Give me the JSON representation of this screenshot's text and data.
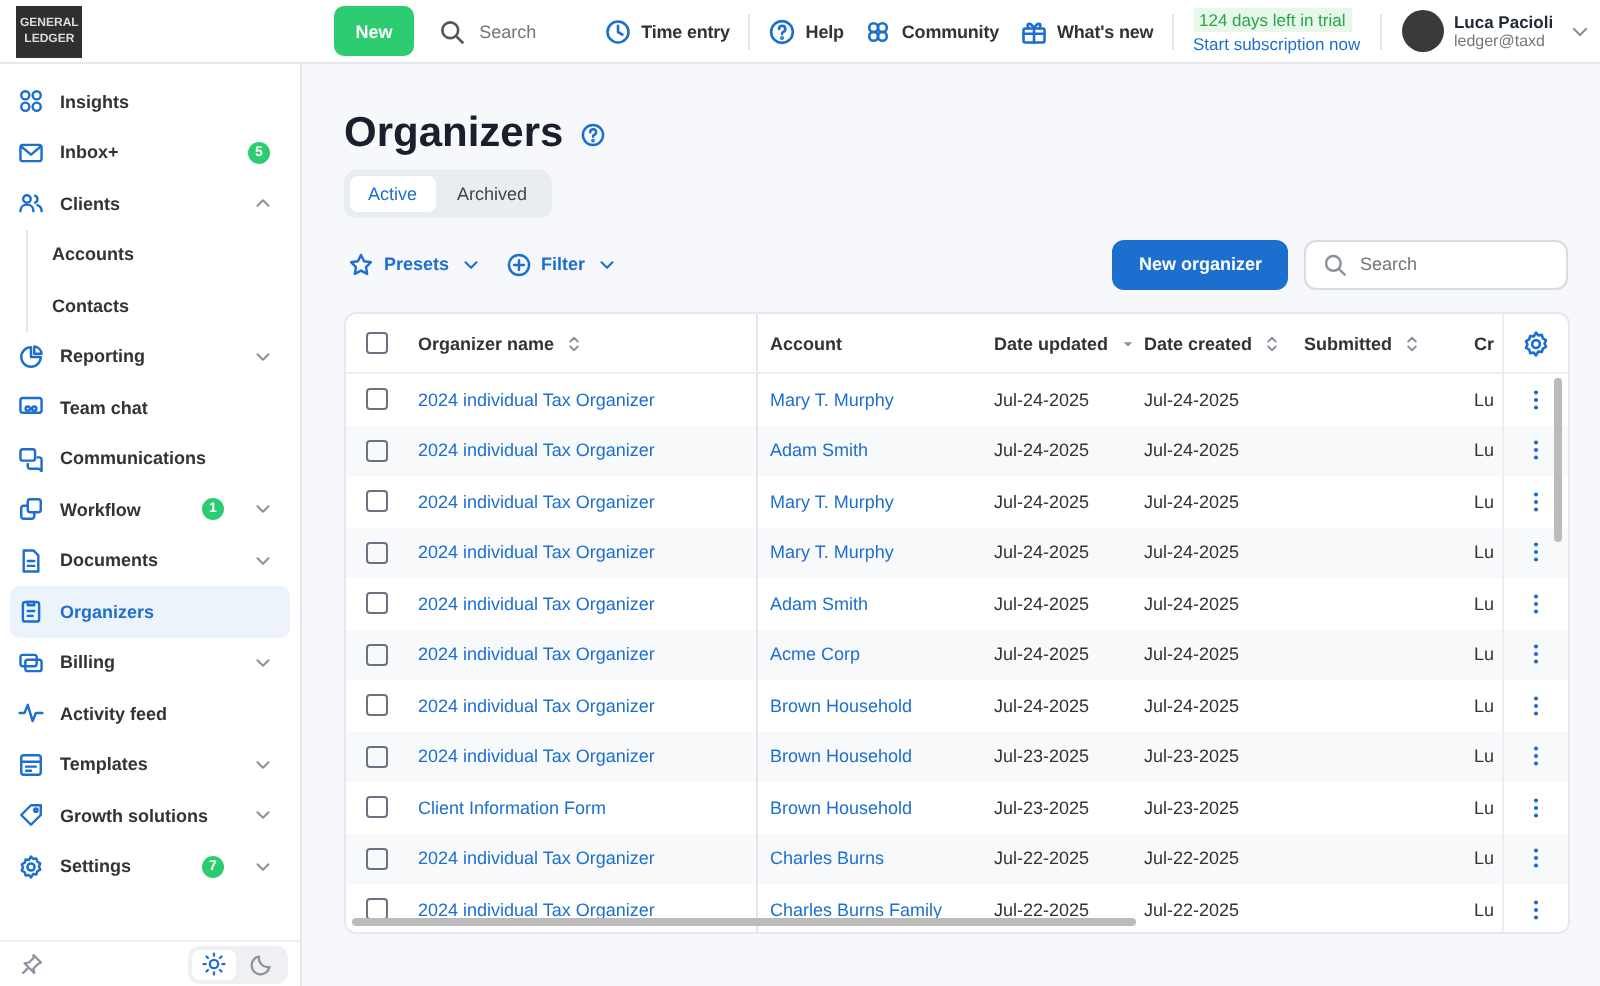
{
  "logo": {
    "lines": [
      "GENERAL",
      "LEDGER"
    ]
  },
  "topbar": {
    "new_button": "New",
    "search": {
      "placeholder": "Search"
    },
    "links": [
      "Time entry",
      "Help",
      "Community",
      "What's new"
    ],
    "trial": {
      "days": "124 days left in trial",
      "cta": "Start subscription now"
    },
    "user": {
      "name": "Luca Pacioli",
      "email": "ledger@taxd"
    }
  },
  "sidebar": {
    "items": [
      {
        "label": "Insights",
        "kind": "link",
        "selected": false
      },
      {
        "label": "Inbox+",
        "kind": "link",
        "selected": false,
        "badge": "5"
      },
      {
        "label": "Clients",
        "kind": "group",
        "selected": false,
        "expanded": true,
        "children": [
          {
            "label": "Accounts",
            "selected": false
          },
          {
            "label": "Contacts",
            "selected": false
          }
        ]
      },
      {
        "label": "Reporting",
        "kind": "group",
        "selected": false,
        "expanded": false
      },
      {
        "label": "Team chat",
        "kind": "link",
        "selected": false
      },
      {
        "label": "Communications",
        "kind": "link",
        "selected": false
      },
      {
        "label": "Workflow",
        "kind": "group",
        "selected": false,
        "expanded": false,
        "badge": "1"
      },
      {
        "label": "Documents",
        "kind": "group",
        "selected": false,
        "expanded": false
      },
      {
        "label": "Organizers",
        "kind": "link",
        "selected": true
      },
      {
        "label": "Billing",
        "kind": "group",
        "selected": false,
        "expanded": false
      },
      {
        "label": "Activity feed",
        "kind": "link",
        "selected": false
      },
      {
        "label": "Templates",
        "kind": "group",
        "selected": false,
        "expanded": false
      },
      {
        "label": "Growth solutions",
        "kind": "group",
        "selected": false,
        "expanded": false
      },
      {
        "label": "Settings",
        "kind": "group",
        "selected": false,
        "expanded": false,
        "badge": "7"
      }
    ],
    "theme": {
      "light_selected": true
    }
  },
  "page": {
    "title": "Organizers",
    "tabs": [
      {
        "label": "Active",
        "selected": true
      },
      {
        "label": "Archived",
        "selected": false
      }
    ],
    "toolbar": {
      "presets": "Presets",
      "filter": "Filter",
      "new_button": "New organizer",
      "search": {
        "placeholder": "Search"
      }
    },
    "table": {
      "select_all": {
        "checked": false
      },
      "columns": [
        {
          "label": "Organizer name",
          "kind": "sortable"
        },
        {
          "label": "Account",
          "kind": "plain"
        },
        {
          "label": "Date updated",
          "kind": "sorted"
        },
        {
          "label": "Date created",
          "kind": "sortable"
        },
        {
          "label": "Submitted",
          "kind": "sortable"
        },
        {
          "label": "Cr",
          "kind": "plain"
        }
      ],
      "rows": [
        {
          "checked": false,
          "cells": [
            "2024 individual Tax Organizer",
            "Mary T. Murphy",
            "Jul-24-2025",
            "Jul-24-2025",
            "",
            "Lu"
          ]
        },
        {
          "checked": false,
          "cells": [
            "2024 individual Tax Organizer",
            "Adam Smith",
            "Jul-24-2025",
            "Jul-24-2025",
            "",
            "Lu"
          ]
        },
        {
          "checked": false,
          "cells": [
            "2024 individual Tax Organizer",
            "Mary T. Murphy",
            "Jul-24-2025",
            "Jul-24-2025",
            "",
            "Lu"
          ]
        },
        {
          "checked": false,
          "cells": [
            "2024 individual Tax Organizer",
            "Mary T. Murphy",
            "Jul-24-2025",
            "Jul-24-2025",
            "",
            "Lu"
          ]
        },
        {
          "checked": false,
          "cells": [
            "2024 individual Tax Organizer",
            "Adam Smith",
            "Jul-24-2025",
            "Jul-24-2025",
            "",
            "Lu"
          ]
        },
        {
          "checked": false,
          "cells": [
            "2024 individual Tax Organizer",
            "Acme Corp",
            "Jul-24-2025",
            "Jul-24-2025",
            "",
            "Lu"
          ]
        },
        {
          "checked": false,
          "cells": [
            "2024 individual Tax Organizer",
            "Brown Household",
            "Jul-24-2025",
            "Jul-24-2025",
            "",
            "Lu"
          ]
        },
        {
          "checked": false,
          "cells": [
            "2024 individual Tax Organizer",
            "Brown Household",
            "Jul-23-2025",
            "Jul-23-2025",
            "",
            "Lu"
          ]
        },
        {
          "checked": false,
          "cells": [
            "Client Information Form",
            "Brown Household",
            "Jul-23-2025",
            "Jul-23-2025",
            "",
            "Lu"
          ]
        },
        {
          "checked": false,
          "cells": [
            "2024 individual Tax Organizer",
            "Charles Burns",
            "Jul-22-2025",
            "Jul-22-2025",
            "",
            "Lu"
          ]
        },
        {
          "checked": false,
          "cells": [
            "2024 individual Tax Organizer",
            "Charles Burns Family",
            "Jul-22-2025",
            "Jul-22-2025",
            "",
            "Lu"
          ]
        }
      ]
    }
  }
}
